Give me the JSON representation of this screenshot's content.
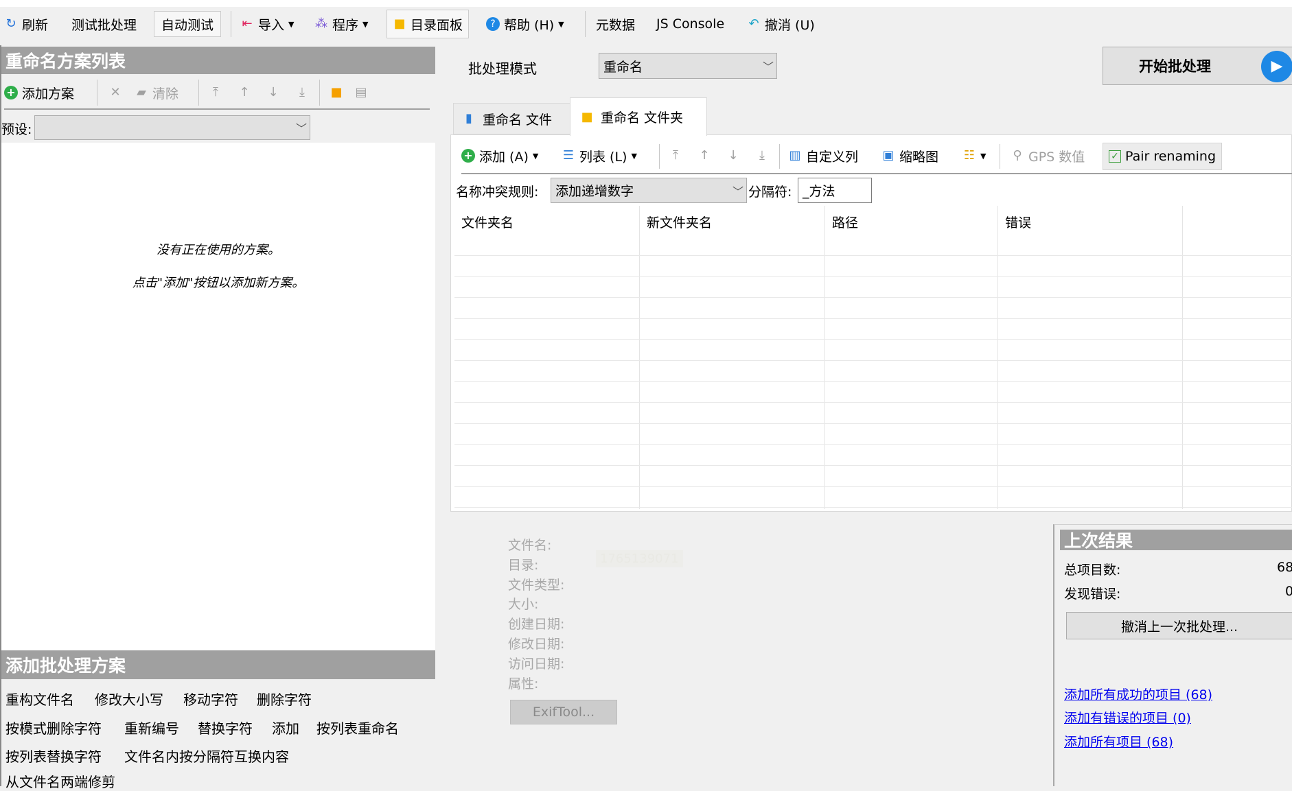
{
  "toolbar": {
    "refresh": "刷新",
    "test_batch": "测试批处理",
    "auto_test": "自动测试",
    "import": "导入",
    "program": "程序",
    "dir_panel": "目录面板",
    "help": "帮助 (H)",
    "metadata": "元数据",
    "js_console": "JS Console",
    "undo": "撤消 (U)"
  },
  "left": {
    "header": "重命名方案列表",
    "add_scheme": "添加方案",
    "clear": "清除",
    "preset_label": "预设:",
    "preset_value": "",
    "empty_line1": "没有正在使用的方案。",
    "empty_line2": "点击\"添加\"按钮以添加新方案。",
    "add_header": "添加批处理方案",
    "plugins": [
      "重构文件名",
      "修改大小写",
      "移动字符",
      "删除字符",
      "按模式删除字符",
      "重新编号",
      "替换字符",
      "添加",
      "按列表重命名",
      "按列表替换字符",
      "文件名内按分隔符互换内容",
      "从文件名两端修剪"
    ]
  },
  "right": {
    "mode_label": "批处理模式",
    "mode_value": "重命名",
    "start": "开始批处理",
    "tabs": [
      "重命名 文件",
      "重命名 文件夹"
    ],
    "active_tab": 1,
    "add": "添加 (A)",
    "list": "列表 (L)",
    "custom_columns": "自定义列",
    "thumbnail": "缩略图",
    "gps": "GPS 数值",
    "pair_renaming": "Pair renaming",
    "pair_checked": true,
    "conflict_label": "名称冲突规则:",
    "conflict_value": "添加递增数字",
    "separator_label": "分隔符:",
    "separator_value": "_方法",
    "columns": [
      "文件夹名",
      "新文件夹名",
      "路径",
      "错误"
    ]
  },
  "info": {
    "labels": [
      "文件名:",
      "目录:",
      "文件类型:",
      "大小:",
      "创建日期:",
      "修改日期:",
      "访问日期:",
      "属性:"
    ],
    "dir_value": "1765139071",
    "exiftool": "ExifTool..."
  },
  "result": {
    "header": "上次结果",
    "total_label": "总项目数:",
    "total_value": "68",
    "errors_label": "发现错误:",
    "errors_value": "0",
    "undo_button": "撤消上一次批处理...",
    "links": [
      "添加所有成功的项目 (68)",
      "添加有错误的项目 (0)",
      "添加所有项目 (68)"
    ]
  },
  "colors": {
    "header_bg": "#a0a0a0",
    "accent": "#1e88e5",
    "link": "#0000ee"
  }
}
